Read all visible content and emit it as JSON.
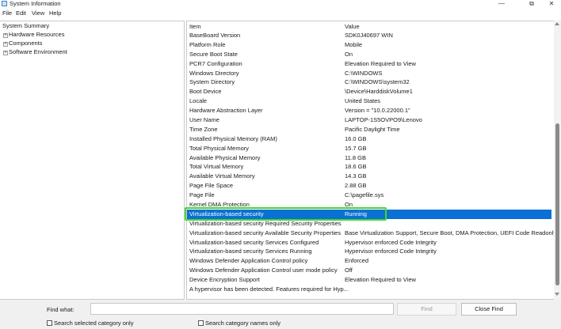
{
  "window": {
    "title": "System Information",
    "minimize_glyph": "—",
    "maximize_glyph": "⧉",
    "close_glyph": "✕"
  },
  "menu": [
    "File",
    "Edit",
    "View",
    "Help"
  ],
  "tree": {
    "root": "System Summary",
    "children": [
      {
        "expander": "+",
        "label": "Hardware Resources"
      },
      {
        "expander": "+",
        "label": "Components"
      },
      {
        "expander": "+",
        "label": "Software Environment"
      }
    ]
  },
  "table": {
    "headers": {
      "item": "Item",
      "value": "Value"
    },
    "selected_index": 20,
    "rows": [
      {
        "item": "BaseBoard Version",
        "value": "SDK0J40697 WIN"
      },
      {
        "item": "Platform Role",
        "value": "Mobile"
      },
      {
        "item": "Secure Boot State",
        "value": "On"
      },
      {
        "item": "PCR7 Configuration",
        "value": "Elevation Required to View"
      },
      {
        "item": "Windows Directory",
        "value": "C:\\WINDOWS"
      },
      {
        "item": "System Directory",
        "value": "C:\\WINDOWS\\system32"
      },
      {
        "item": "Boot Device",
        "value": "\\Device\\HarddiskVolume1"
      },
      {
        "item": "Locale",
        "value": "United States"
      },
      {
        "item": "Hardware Abstraction Layer",
        "value": "Version = \"10.0.22000.1\""
      },
      {
        "item": "User Name",
        "value": "LAPTOP-1S5OVPO9\\Lenovo"
      },
      {
        "item": "Time Zone",
        "value": "Pacific Daylight Time"
      },
      {
        "item": "Installed Physical Memory (RAM)",
        "value": "16.0 GB"
      },
      {
        "item": "Total Physical Memory",
        "value": "15.7 GB"
      },
      {
        "item": "Available Physical Memory",
        "value": "11.8 GB"
      },
      {
        "item": "Total Virtual Memory",
        "value": "18.6 GB"
      },
      {
        "item": "Available Virtual Memory",
        "value": "14.3 GB"
      },
      {
        "item": "Page File Space",
        "value": "2.88 GB"
      },
      {
        "item": "Page File",
        "value": "C:\\pagefile.sys"
      },
      {
        "item": "Kernel DMA Protection",
        "value": "On"
      },
      {
        "item": "Virtualization-based security",
        "value": "Running"
      },
      {
        "item": "Virtualization-based security Required Security Properties",
        "value": ""
      },
      {
        "item": "Virtualization-based security Available Security Properties",
        "value": "Base Virtualization Support, Secure Boot, DMA Protection, UEFI Code Readonly..."
      },
      {
        "item": "Virtualization-based security Services Configured",
        "value": "Hypervisor enforced Code Integrity"
      },
      {
        "item": "Virtualization-based security Services Running",
        "value": "Hypervisor enforced Code Integrity"
      },
      {
        "item": "Windows Defender Application Control policy",
        "value": "Enforced"
      },
      {
        "item": "Windows Defender Application Control user mode policy",
        "value": "Off"
      },
      {
        "item": "Device Encryption Support",
        "value": "Elevation Required to View"
      },
      {
        "item": "A hypervisor has been detected. Features required for Hyp...",
        "value": ""
      }
    ]
  },
  "find": {
    "label": "Find what:",
    "value": "",
    "find_button": "Find",
    "close_button": "Close Find",
    "checkbox_selected": "Search selected category only",
    "checkbox_names": "Search category names only"
  },
  "colors": {
    "selection": "#0a70d3",
    "highlight_outline": "#47d631"
  }
}
